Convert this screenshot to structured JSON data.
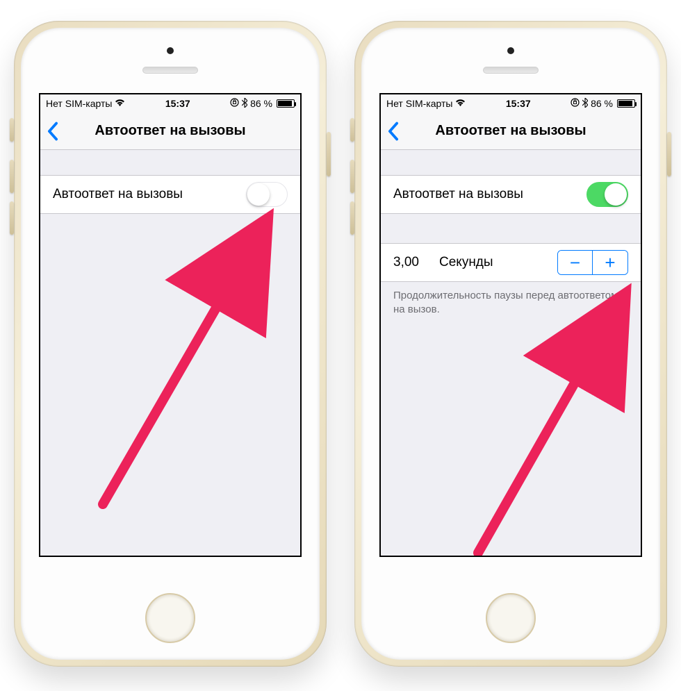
{
  "status": {
    "carrier": "Нет SIM-карты",
    "time": "15:37",
    "battery_pct": "86 %"
  },
  "nav": {
    "title": "Автоответ на вызовы"
  },
  "row": {
    "autoanswer_label": "Автоответ на вызовы"
  },
  "stepper": {
    "value": "3,00",
    "unit": "Секунды",
    "minus": "−",
    "plus": "+"
  },
  "note": "Продолжительность паузы перед автоответом на вызов."
}
